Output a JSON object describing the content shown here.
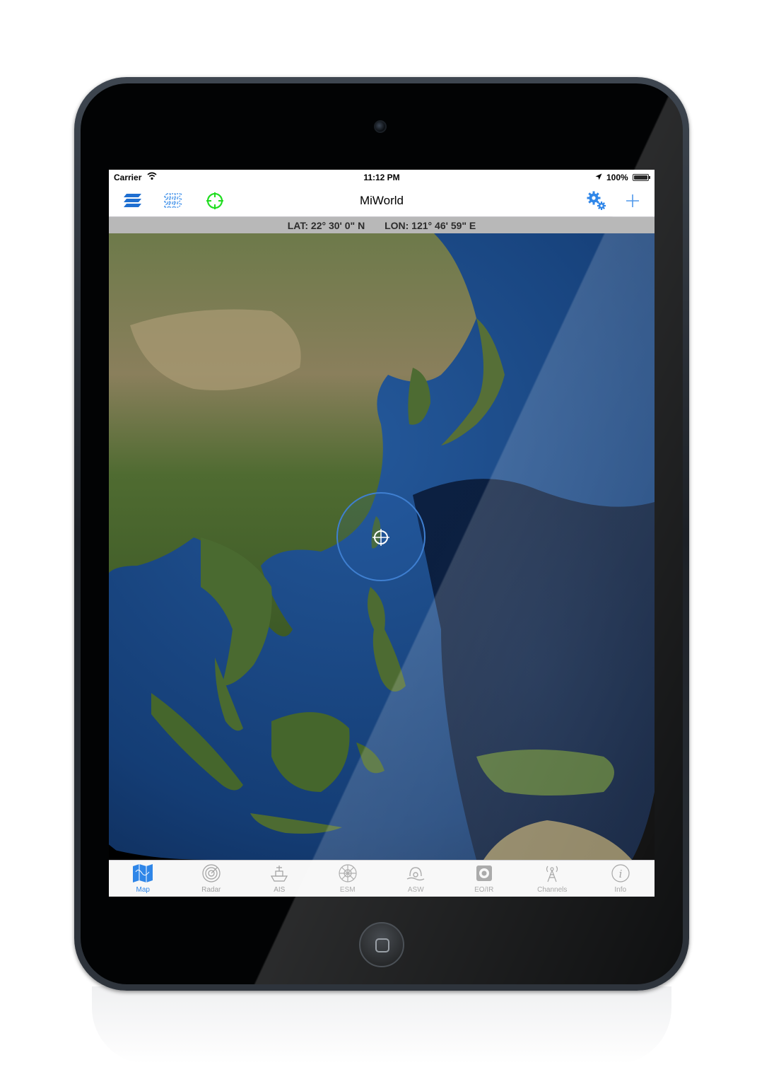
{
  "status_bar": {
    "carrier": "Carrier",
    "time": "11:12 PM",
    "battery": "100%"
  },
  "nav_bar": {
    "title": "MiWorld",
    "left_icons": [
      "layers-icon",
      "grid-overlay-icon",
      "crosshair-target-icon"
    ],
    "right_icons": [
      "settings-gears-icon",
      "add-icon"
    ]
  },
  "coordinates": {
    "lat": "LAT: 22° 30' 0\" N",
    "lon": "LON: 121° 46' 59\" E"
  },
  "tabs": [
    {
      "label": "Map",
      "icon": "map-icon",
      "active": true
    },
    {
      "label": "Radar",
      "icon": "radar-icon",
      "active": false
    },
    {
      "label": "AIS",
      "icon": "ship-icon",
      "active": false
    },
    {
      "label": "ESM",
      "icon": "esm-wheel-icon",
      "active": false
    },
    {
      "label": "ASW",
      "icon": "sonar-icon",
      "active": false
    },
    {
      "label": "EO/IR",
      "icon": "camera-sensor-icon",
      "active": false
    },
    {
      "label": "Channels",
      "icon": "antenna-tower-icon",
      "active": false
    },
    {
      "label": "Info",
      "icon": "info-icon",
      "active": false
    }
  ],
  "colors": {
    "accent": "#2f86e8",
    "target_green": "#22dd22",
    "ocean": "#1c4f8e",
    "land": "#4d6b32"
  }
}
